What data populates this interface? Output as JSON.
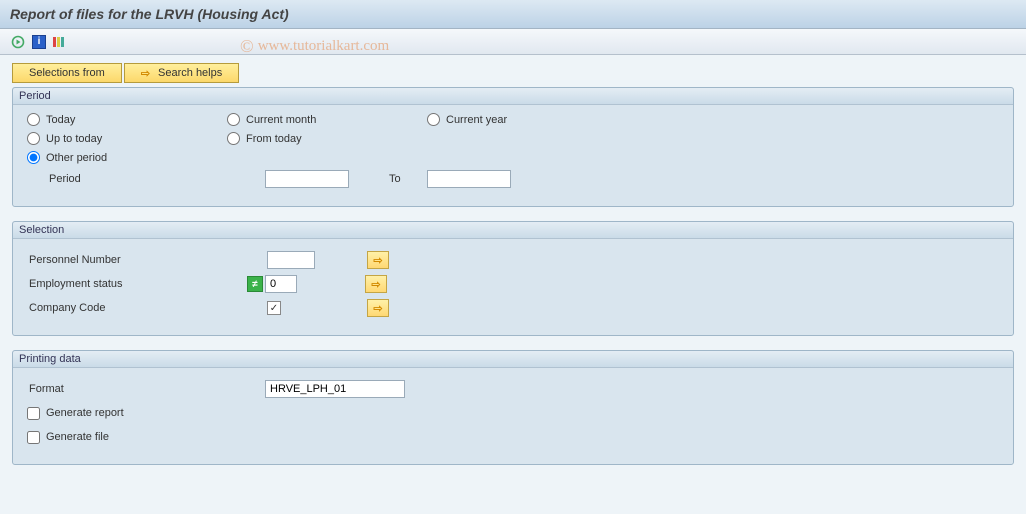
{
  "title": "Report of files for the LRVH (Housing Act)",
  "watermark": "www.tutorialkart.com",
  "toolbar": {
    "icons": [
      "execute",
      "info",
      "variant"
    ]
  },
  "buttons": {
    "selections_from": "Selections from",
    "search_helps": "Search helps"
  },
  "groups": {
    "period": {
      "title": "Period",
      "radios": {
        "today": "Today",
        "current_month": "Current month",
        "current_year": "Current year",
        "up_to_today": "Up to today",
        "from_today": "From today",
        "other_period": "Other period"
      },
      "selected": "other_period",
      "period_label": "Period",
      "period_from": "",
      "to_label": "To",
      "period_to": ""
    },
    "selection": {
      "title": "Selection",
      "rows": {
        "personnel_number": {
          "label": "Personnel Number",
          "value": ""
        },
        "employment_status": {
          "label": "Employment status",
          "value": "0",
          "badge": "≠"
        },
        "company_code": {
          "label": "Company Code",
          "value": "",
          "checkmark": "☑"
        }
      }
    },
    "printing": {
      "title": "Printing data",
      "format_label": "Format",
      "format_value": "HRVE_LPH_01",
      "gen_report": "Generate report",
      "gen_file": "Generate file",
      "gen_report_checked": false,
      "gen_file_checked": false
    }
  }
}
